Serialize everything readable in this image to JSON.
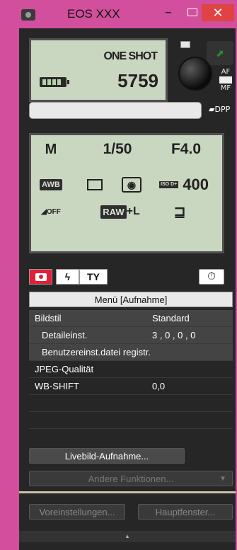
{
  "window": {
    "title": "EOS XXX",
    "minimize": "–",
    "close": "✕"
  },
  "top_lcd": {
    "af_mode": "ONE SHOT",
    "shots_remaining": "5759",
    "battery_level": 1.0
  },
  "lens_switch": {
    "af": "AF",
    "mf": "MF"
  },
  "dpp_label": "DPP",
  "main_lcd": {
    "shooting_mode": "M",
    "shutter": "1/50",
    "aperture": "F4.0",
    "wb": "AWB",
    "drive_icon": "single-shot-icon",
    "metering_icon": "evaluative-metering-icon",
    "iso_prefix": "ISO D+",
    "iso": "400",
    "alo_icon": "auto-lighting-optimizer-off-icon",
    "alo_text": "OFF",
    "quality_raw": "RAW",
    "quality_plus": "+L",
    "pc_transfer_icon": "pc-transfer-icon"
  },
  "tabs": [
    {
      "name": "camera-tab",
      "icon": "camera-icon",
      "glyph": "",
      "active": true
    },
    {
      "name": "flash-tab",
      "icon": "flash-icon",
      "glyph": "ϟ",
      "active": false
    },
    {
      "name": "tools-tab",
      "icon": "tools-icon",
      "glyph": "TY",
      "active": false
    }
  ],
  "timer_glyph": "⏱",
  "menu": {
    "title": "Menü [Aufnahme]",
    "rows": [
      {
        "label": "Bildstil",
        "value": "Standard",
        "indent": false
      },
      {
        "label": "Detaileinst.",
        "value": "3 , 0 , 0 , 0",
        "indent": true
      },
      {
        "label": "Benutzereinst.datei registr.",
        "value": "",
        "indent": true
      },
      {
        "label": "JPEG-Qualität",
        "value": "",
        "indent": false
      },
      {
        "label": "WB-SHIFT",
        "value": "0,0",
        "indent": false
      }
    ]
  },
  "buttons": {
    "live_view": "Livebild-Aufnahme...",
    "other_functions": "Andere Funktionen...",
    "preferences": "Voreinstellungen...",
    "main_window": "Hauptfenster..."
  }
}
